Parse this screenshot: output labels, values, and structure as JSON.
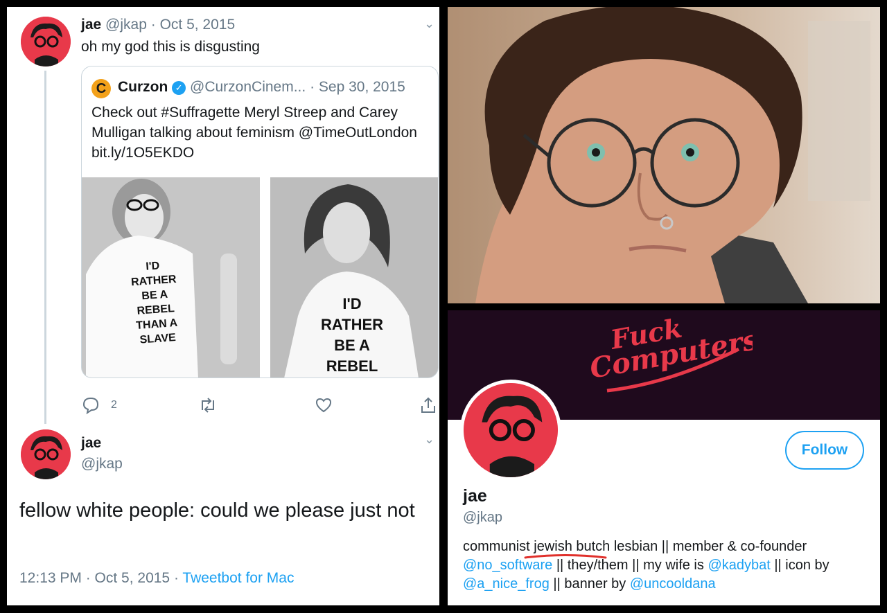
{
  "tweet1": {
    "name": "jae",
    "handle": "@jkap",
    "date_sep": "·",
    "date": "Oct 5, 2015",
    "text": "oh my god this is disgusting",
    "quoted": {
      "name": "Curzon",
      "handle": "@CurzonCinem...",
      "date": "· Sep 30, 2015",
      "text": "Check out #Suffragette Meryl Streep and Carey Mulligan talking about feminism @TimeOutLondon bit.ly/1O5EKDO",
      "image1_shirt": [
        "I'D",
        "RATHER",
        "BE A",
        "REBEL",
        "THAN A",
        "SLAVE"
      ],
      "image2_shirt": [
        "I'D",
        "RATHER",
        "BE A",
        "REBEL"
      ]
    },
    "reply_count": "2"
  },
  "tweet2": {
    "name": "jae",
    "handle": "@jkap",
    "text": "fellow white people: could we please just not",
    "time": "12:13 PM · Oct 5, 2015 · ",
    "client": "Tweetbot for Mac"
  },
  "profile": {
    "banner_text_1": "Fuck",
    "banner_text_2": "Computers",
    "follow_label": "Follow",
    "name": "jae",
    "handle": "@jkap",
    "bio": {
      "p1": "communist jewish butch lesbian || member & co-founder",
      "link1": "@no_software",
      "p2": " || they/them || my wife is ",
      "link2": "@kadybat",
      "p3": " || icon by",
      "link3": "@a_nice_frog",
      "p4": " || banner by ",
      "link4": "@uncooldana"
    }
  },
  "colors": {
    "accent": "#1da1f2",
    "avatar_bg": "#e8394a",
    "banner_bg": "#1f0a1d",
    "underline": "#e0302b"
  }
}
